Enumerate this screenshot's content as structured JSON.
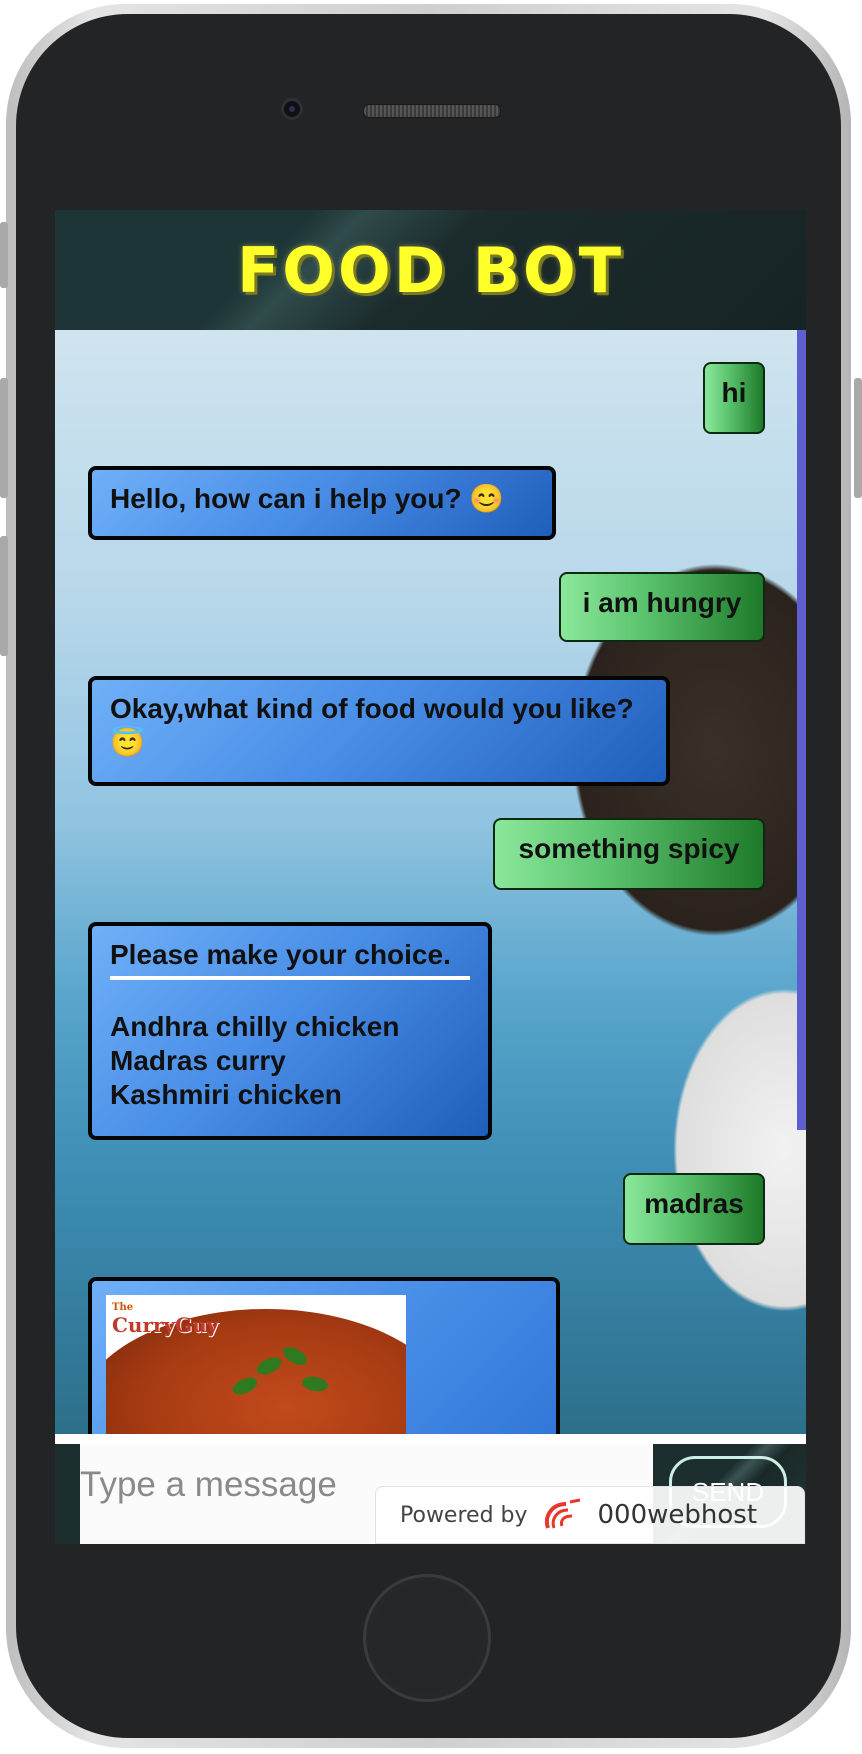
{
  "app": {
    "title": "FOOD BOT"
  },
  "messages": [
    {
      "sender": "user",
      "text": "hi"
    },
    {
      "sender": "bot",
      "text": "Hello, how can i help you? 😊"
    },
    {
      "sender": "user",
      "text": "i am hungry"
    },
    {
      "sender": "bot",
      "text": "Okay,what kind of food would you like? 😇"
    },
    {
      "sender": "user",
      "text": "something spicy"
    },
    {
      "sender": "bot",
      "title": "Please make your choice.",
      "options": [
        "Andhra chilly chicken",
        "Madras curry",
        "Kashmiri chicken"
      ]
    },
    {
      "sender": "user",
      "text": "madras"
    },
    {
      "sender": "bot",
      "image_brand": "CurryGuy",
      "image_brand_prefix": "The"
    }
  ],
  "composer": {
    "placeholder": "Type a message",
    "send_label": "SEND"
  },
  "powered_by": {
    "label": "Powered by",
    "brand": "000webhost"
  }
}
